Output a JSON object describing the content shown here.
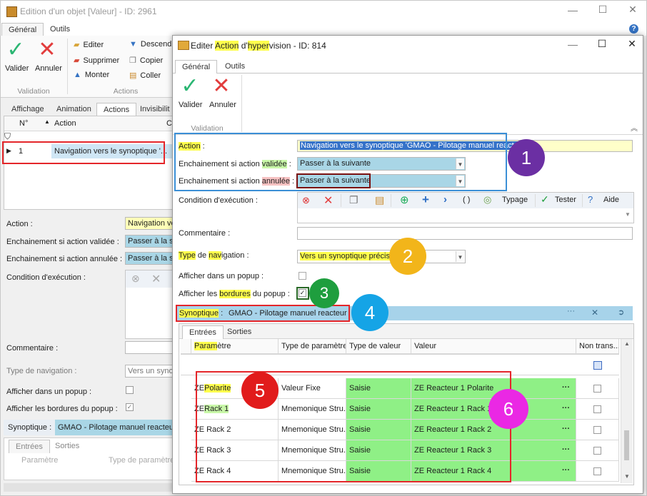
{
  "outer": {
    "title": "Edition d'un objet [Valeur] - ID: 2961",
    "tabs": [
      "Général",
      "Outils"
    ],
    "ribbon": {
      "valider": "Valider",
      "annuler": "Annuler",
      "validation_group": "Validation",
      "editer": "Editer",
      "supprimer": "Supprimer",
      "monter": "Monter",
      "descendre": "Descendr",
      "copier": "Copier",
      "coller": "Coller",
      "actions_group": "Actions"
    },
    "subtabs": [
      "Affichage",
      "Animation",
      "Actions",
      "Invisibilit"
    ],
    "grid": {
      "col_no": "N°",
      "col_action": "Action",
      "col_c": "C",
      "row_no": "1",
      "row_action": "Navigation vers le synoptique '..."
    },
    "form": {
      "action_label": "Action :",
      "action_value": "Navigation ver",
      "valid_label": "Enchainement si action validée :",
      "valid_value": "Passer à la su",
      "annul_label": "Enchainement si action annulée :",
      "annul_value": "Passer à la su",
      "cond_label": "Condition d'exécution :",
      "comment_label": "Commentaire :",
      "typenav_label": "Type de navigation :",
      "typenav_value": "Vers un syno",
      "popup_label": "Afficher dans un popup :",
      "borders_label": "Afficher les bordures du popup :",
      "synop_label": "Synoptique :",
      "synop_value": "GMAO - Pilotage manuel reacteur",
      "subtab_entrees": "Entrées",
      "subtab_sorties": "Sorties",
      "col_param": "Paramètre",
      "col_type": "Type de paramètre"
    }
  },
  "inner": {
    "title_prefix": "Editer ",
    "title_action": "Action",
    "title_d": " d'",
    "title_hyper": "hyper",
    "title_vision": "vision",
    "title_id": " - ID: 814",
    "tabs": [
      "Général",
      "Outils"
    ],
    "valider": "Valider",
    "annuler": "Annuler",
    "validation_group": "Validation",
    "action_label": "Action",
    "action_colon": " :",
    "action_value": "Navigation vers le synoptique 'GMAO - Pilotage manuel reacteur'",
    "valid_label_a": "Enchainement si action ",
    "valid_label_b": "validée",
    "valid_label_c": " :",
    "valid_value": "Passer à la suivante",
    "annul_label_a": "Enchainement si action ",
    "annul_label_b": "annulée",
    "annul_label_c": " :",
    "annul_value": "Passer à la suivante",
    "cond_label": "Condition d'exécution :",
    "toolbar": {
      "parens": "( )",
      "typage": "Typage",
      "tester": "Tester",
      "aide": "Aide"
    },
    "comment_label": "Commentaire :",
    "typenav_label_a": "Type",
    "typenav_label_b": " de ",
    "typenav_label_c": "nav",
    "typenav_label_d": "igation :",
    "typenav_value": "Vers un synoptique précis",
    "popup_label": "Afficher dans un popup :",
    "borders_label_a": "Afficher les ",
    "borders_label_b": "bordures",
    "borders_label_c": " du popup :",
    "synop_label_a": "Synoptique",
    "synop_label_b": " :",
    "synop_value": "GMAO - Pilotage manuel reacteur",
    "subtab_entrees": "Entrées",
    "subtab_sorties": "Sorties",
    "grid_headers": {
      "param_a": "Param",
      "param_b": "ètre",
      "type_param": "Type de paramètre",
      "type_valeur": "Type de valeur",
      "valeur": "Valeur",
      "non_trans": "Non trans..."
    },
    "rows": [
      {
        "param_a": "ZE ",
        "param_b": "Polarite",
        "type": "Valeur Fixe",
        "tv": "Saisie",
        "val": "ZE Reacteur 1 Polarite",
        "dots": "···"
      },
      {
        "param_a": "ZE ",
        "param_b": "Rack 1",
        "type": "Mnemonique Stru...",
        "tv": "Saisie",
        "val": "ZE Reacteur 1 Rack 1",
        "dots": "···"
      },
      {
        "param_a": "ZE Rack 2",
        "param_b": "",
        "type": "Mnemonique Stru...",
        "tv": "Saisie",
        "val": "ZE Reacteur 1 Rack 2",
        "dots": "···"
      },
      {
        "param_a": "ZE Rack 3",
        "param_b": "",
        "type": "Mnemonique Stru...",
        "tv": "Saisie",
        "val": "ZE Reacteur 1 Rack 3",
        "dots": "···"
      },
      {
        "param_a": "ZE Rack 4",
        "param_b": "",
        "type": "Mnemonique Stru...",
        "tv": "Saisie",
        "val": "ZE Reacteur 1 Rack 4",
        "dots": "···"
      }
    ]
  },
  "badges": [
    "1",
    "2",
    "3",
    "4",
    "5",
    "6"
  ],
  "colors": {
    "badge1": "#6b2fa3",
    "badge2": "#f2b51a",
    "badge3": "#1e9e3e",
    "badge4": "#15a4e6",
    "badge5": "#e11b1b",
    "badge6": "#ea28e4"
  }
}
